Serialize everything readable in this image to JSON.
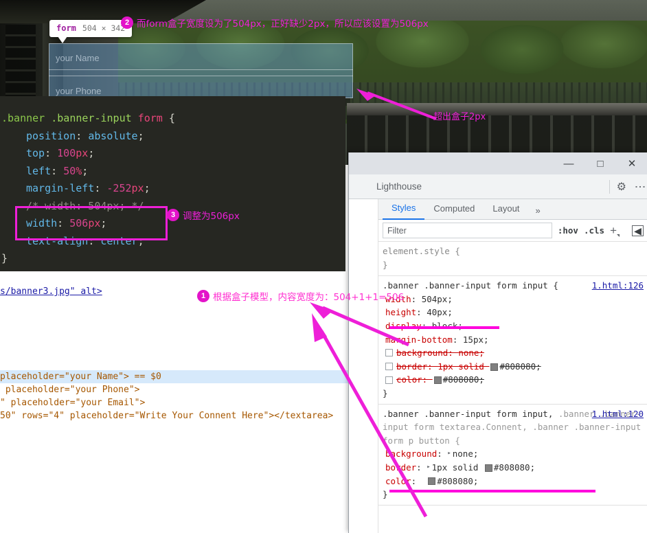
{
  "banner": {
    "tooltip": {
      "element_name": "form",
      "dimensions": "504 × 342"
    },
    "inputs": [
      {
        "placeholder": "your Name"
      },
      {
        "placeholder": "your Phone"
      }
    ]
  },
  "annotations": {
    "one": {
      "badge": "1",
      "text": "根据盒子模型，内容宽度为：504+1+1=506"
    },
    "two": {
      "badge": "2",
      "text": "而form盒子宽度设为了504px，正好缺少2px，所以应该设置为506px"
    },
    "three": {
      "badge": "3",
      "text": "调整为506px"
    },
    "overflow": {
      "text": "超出盒子2px"
    }
  },
  "code_editor": {
    "selector_part1": ".banner",
    "selector_part2": ".banner-input",
    "selector_part3": "form",
    "open_brace": "{",
    "close_brace": "}",
    "declarations": [
      {
        "prop": "position",
        "value": "absolute",
        "unit": ""
      },
      {
        "prop": "top",
        "value": "100",
        "unit": "px"
      },
      {
        "prop": "left",
        "value": "50",
        "unit": "%"
      },
      {
        "prop": "margin-left",
        "value": "-252",
        "unit": "px"
      }
    ],
    "commented_line": "/* width: 504px; */",
    "highlighted_prop": "width",
    "highlighted_value": "506",
    "highlighted_unit": "px",
    "last_prop": "text-align",
    "last_value": "center"
  },
  "source_code": {
    "line_img": "s/banner3.jpg\" alt>",
    "lines": [
      {
        "text": "placeholder=\"your Name\"> == $0",
        "selected": true
      },
      {
        "text": " placeholder=\"your Phone\">",
        "selected": false
      },
      {
        "text": "\" placeholder=\"your Email\">",
        "selected": false
      },
      {
        "text": "50\" rows=\"4\" placeholder=\"Write Your Connent Here\"></textarea>",
        "selected": false
      }
    ]
  },
  "browser": {
    "window_controls": {
      "minimize": "—",
      "maximize": "□",
      "close": "✕"
    },
    "devtools_tab": "Lighthouse",
    "gear_icon": "gear-icon",
    "kebab_icon": "kebab-menu-icon"
  },
  "devtools": {
    "tabs": [
      {
        "label": "Styles",
        "active": true
      },
      {
        "label": "Computed",
        "active": false
      },
      {
        "label": "Layout",
        "active": false
      }
    ],
    "more_tabs": "»",
    "filter": {
      "placeholder": "Filter",
      "value": ""
    },
    "toolbar": {
      "hov": ":hov",
      "cls": ".cls",
      "plus": "+",
      "panel": "◧"
    },
    "element_style": {
      "selector": "element.style {",
      "close": "}"
    },
    "rules": [
      {
        "selector_main": ".banner .banner-input form input {",
        "selector_dim": "",
        "source": "1.html:126",
        "declarations": [
          {
            "prop": "width",
            "value": "504px;",
            "struck": false,
            "checkbox": false,
            "underlined": true
          },
          {
            "prop": "height",
            "value": "40px;",
            "struck": false,
            "checkbox": false,
            "underlined": false
          },
          {
            "prop": "display",
            "value": "block;",
            "struck": false,
            "checkbox": false,
            "underlined": false
          },
          {
            "prop": "margin-bottom",
            "value": "15px;",
            "struck": false,
            "checkbox": false,
            "underlined": false
          },
          {
            "prop": "background",
            "value": "none;",
            "struck": true,
            "checkbox": true,
            "underlined": false
          },
          {
            "prop": "border",
            "value": "1px solid #808080;",
            "struck": true,
            "checkbox": true,
            "underlined": false,
            "swatch": "#808080"
          },
          {
            "prop": "color",
            "value": "#808080;",
            "struck": true,
            "checkbox": true,
            "underlined": false,
            "swatch": "#808080"
          }
        ],
        "close": "}"
      },
      {
        "selector_main": ".banner .banner-input form input,",
        "selector_dim": " .banner .banner-input form textarea.Connent, .banner .banner-input form p button {",
        "source": "1.html:120",
        "declarations": [
          {
            "prop": "background",
            "value": "none;",
            "struck": false,
            "checkbox": false,
            "underlined": false,
            "tri": true
          },
          {
            "prop": "border",
            "value": "1px solid #808080;",
            "struck": false,
            "checkbox": false,
            "underlined": true,
            "tri": true,
            "swatch": "#808080"
          },
          {
            "prop": "color",
            "value": "#808080;",
            "struck": false,
            "checkbox": false,
            "underlined": false,
            "swatch": "#808080"
          }
        ],
        "close": "}"
      }
    ]
  },
  "colors": {
    "annotation": "#ee1fd8",
    "badge": "#e313c9",
    "highlight_box": "#ee1fd8",
    "underline": "#ff00dd",
    "devtools_accent": "#1a73e8",
    "swatch_gray": "#808080",
    "element_highlight": "rgba(111,168,220,.45)"
  }
}
